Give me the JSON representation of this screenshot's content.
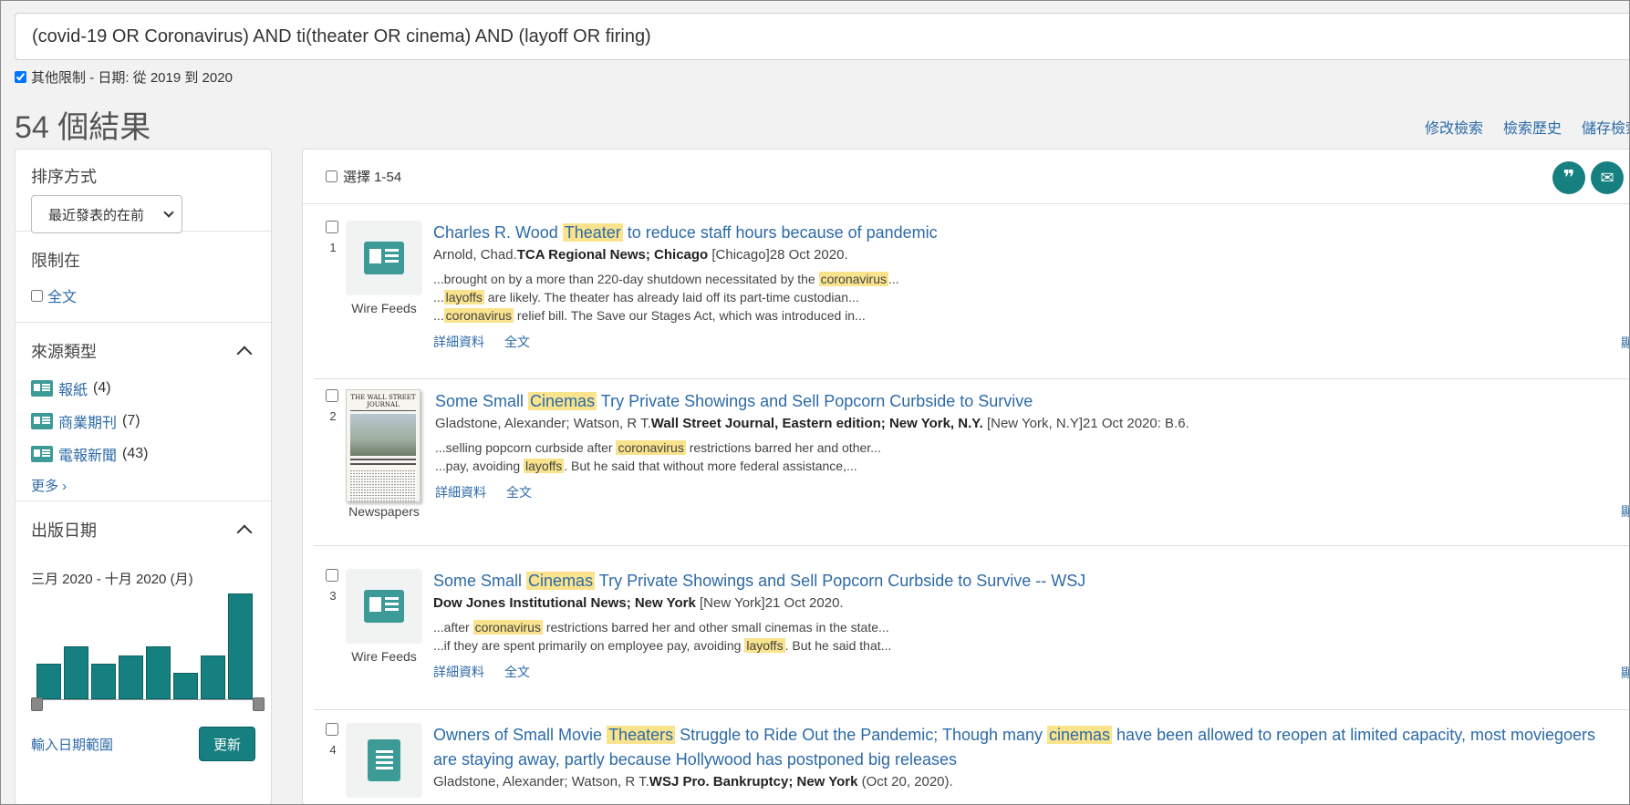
{
  "search": {
    "query": "(covid-19 OR Coronavirus) AND ti(theater OR cinema) AND (layoff OR firing)",
    "other_limits": "其他限制 - 日期: 從 2019 到 2020"
  },
  "result_count": "54 個結果",
  "top_links": [
    "修改檢索",
    "檢索歷史",
    "儲存檢索"
  ],
  "sidebar": {
    "sort_heading": "排序方式",
    "sort_value": "最近發表的在前",
    "limit_heading": "限制在",
    "fulltext_label": "全文",
    "source_heading": "來源類型",
    "sources": [
      {
        "label": "報紙",
        "count": "(4)"
      },
      {
        "label": "商業期刊",
        "count": "(7)"
      },
      {
        "label": "電報新聞",
        "count": "(43)"
      }
    ],
    "more_label": "更多 ›",
    "pubdate_heading": "出版日期",
    "date_range": "三月 2020 - 十月 2020 (月)",
    "histogram_values": [
      4,
      6,
      4,
      5,
      6,
      3,
      5,
      12
    ],
    "enter_range_label": "輸入日期範圍",
    "update_label": "更新"
  },
  "results_header": {
    "select_label": "選擇 1-54",
    "cite_icon": "quote-icon",
    "email_icon": "email-icon"
  },
  "results": [
    {
      "num": "1",
      "type": "Wire Feeds",
      "title_pre": "Charles R. Wood ",
      "title_hl": "Theater",
      "title_post": " to reduce staff hours because of pandemic",
      "author": "Arnold, Chad.",
      "source": "TCA Regional News; Chicago",
      "source_tail": " [Chicago]28 Oct 2020.",
      "snippets": [
        {
          "pre": "...brought on by a more than 220-day shutdown necessitated by the ",
          "hl": "coronavirus",
          "post": "..."
        },
        {
          "pre": "...",
          "hl": "layoffs",
          "post": " are likely. The theater has already laid off its part-time custodian..."
        },
        {
          "pre": "...",
          "hl": "coronavirus",
          "post": " relief bill. The Save our Stages Act, which was introduced in..."
        }
      ],
      "links": [
        "詳細資料",
        "全文"
      ]
    },
    {
      "num": "2",
      "type": "Newspapers",
      "thumb_masthead": "THE WALL STREET JOURNAL",
      "title_pre": "Some Small ",
      "title_hl": "Cinemas",
      "title_post": " Try Private Showings and Sell Popcorn Curbside to Survive",
      "author": "Gladstone, Alexander; Watson, R T.",
      "source": "Wall Street Journal, Eastern edition; New York, N.Y.",
      "source_tail": " [New York, N.Y]21 Oct 2020: B.6.",
      "snippets": [
        {
          "pre": "...selling popcorn curbside after ",
          "hl": "coronavirus",
          "post": " restrictions barred her and other..."
        },
        {
          "pre": "...pay, avoiding ",
          "hl": "layoffs",
          "post": ". But he said that without more federal assistance,..."
        }
      ],
      "links": [
        "詳細資料",
        "全文"
      ]
    },
    {
      "num": "3",
      "type": "Wire Feeds",
      "title_pre": "Some Small ",
      "title_hl": "Cinemas",
      "title_post": " Try Private Showings and Sell Popcorn Curbside to Survive -- WSJ",
      "author": "",
      "source": "Dow Jones Institutional News; New York",
      "source_tail": " [New York]21 Oct 2020.",
      "snippets": [
        {
          "pre": "...after ",
          "hl": "coronavirus",
          "post": " restrictions barred her and other small cinemas in the state..."
        },
        {
          "pre": "...if they are spent primarily on employee pay, avoiding ",
          "hl": "layoffs",
          "post": ". But he said that..."
        }
      ],
      "links": [
        "詳細資料",
        "全文"
      ]
    },
    {
      "num": "4",
      "title_a": "Owners of Small Movie ",
      "title_hl1": "Theaters",
      "title_b": " Struggle to Ride Out the Pandemic; Though many ",
      "title_hl2": "cinemas",
      "title_c": " have been allowed to reopen at limited capacity, most moviegoers are staying away, partly because Hollywood has postponed big releases",
      "author": "Gladstone, Alexander; Watson, R T.",
      "source": "WSJ Pro. Bankruptcy; New York",
      "source_tail": " (Oct 20, 2020)."
    }
  ],
  "edge_glyph": "顯"
}
